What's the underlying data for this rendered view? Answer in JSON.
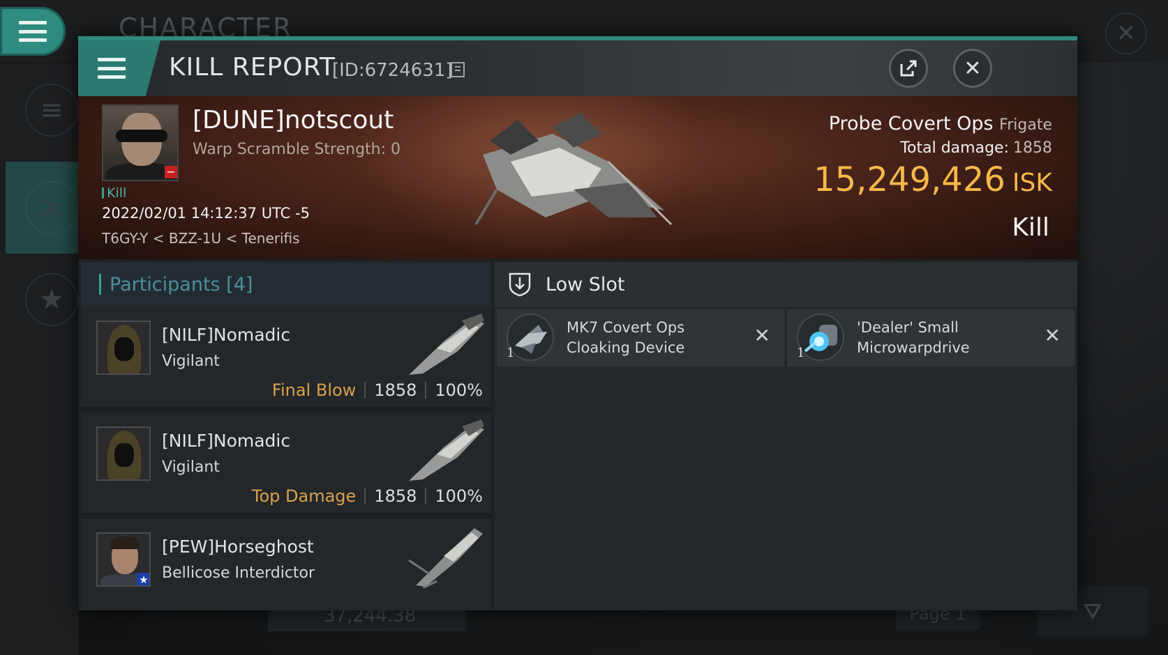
{
  "background": {
    "title": "CHARACTER",
    "bottom_value": "37,244.38",
    "page_label": "Page 1"
  },
  "dialog": {
    "title": "KILL REPORT",
    "id_label": "[ID:6724631]"
  },
  "victim": {
    "name": "[DUNE]notscout",
    "warp_scramble": "Warp Scramble Strength: 0",
    "tag": "Kill",
    "datetime": "2022/02/01 14:12:37 UTC -5",
    "location": "T6GY-Y < BZZ-1U < Tenerifis",
    "ship_name": "Probe Covert Ops",
    "ship_class": "Frigate",
    "total_damage_label": "Total damage:",
    "total_damage": "1858",
    "isk_value": "15,249,426",
    "isk_unit": "ISK",
    "result": "Kill"
  },
  "participants": {
    "header": "Participants [4]",
    "rows": [
      {
        "name": "[NILF]Nomadic",
        "ship": "Vigilant",
        "tag": "Final Blow",
        "damage": "1858",
        "percent": "100%"
      },
      {
        "name": "[NILF]Nomadic",
        "ship": "Vigilant",
        "tag": "Top Damage",
        "damage": "1858",
        "percent": "100%"
      },
      {
        "name": "[PEW]Horseghost",
        "ship": "Bellicose Interdictor"
      }
    ]
  },
  "lowslot": {
    "title": "Low Slot",
    "modules": [
      {
        "name": "MK7 Covert Ops Cloaking Device",
        "qty": "1"
      },
      {
        "name": "'Dealer' Small Microwarpdrive",
        "qty": "1"
      }
    ]
  },
  "colors": {
    "accent": "#2f8a7f",
    "isk": "#f5b84a",
    "final_blow": "#d9a14a",
    "banner": "#4a241a"
  },
  "icons": [
    "menu-icon",
    "share-icon",
    "close-icon",
    "copy-icon",
    "shield-icon",
    "remove-icon",
    "star-icon",
    "filter-icon"
  ]
}
